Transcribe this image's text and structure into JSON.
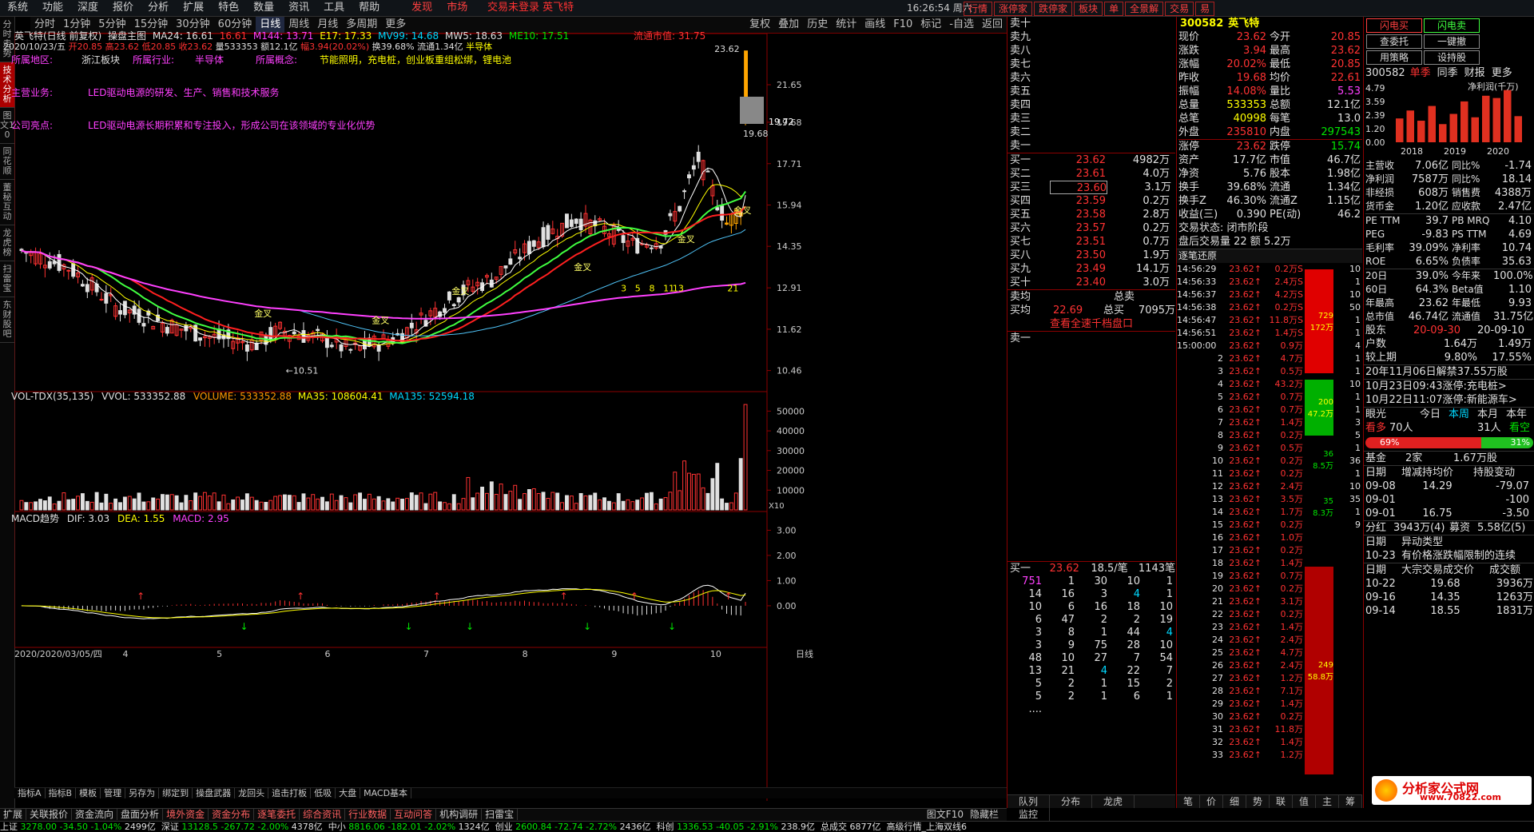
{
  "menu": [
    "系统",
    "功能",
    "深度",
    "报价",
    "分析",
    "扩展",
    "特色",
    "数量",
    "资讯",
    "工具",
    "帮助"
  ],
  "menu_hot": [
    "发现",
    "市场"
  ],
  "login_status": "交易未登录",
  "stock_name_title": "英飞特",
  "clock": "16:26:54",
  "weekday": "周六",
  "top_right_buttons": [
    "行情",
    "涨停家",
    "跌停家",
    "板块",
    "单",
    "全景解",
    "交易",
    "易"
  ],
  "toolbar_left": [
    "分时",
    "1分钟",
    "5分钟",
    "15分钟",
    "30分钟",
    "60分钟",
    "日线",
    "周线",
    "月线",
    "多周期",
    "更多"
  ],
  "toolbar_right": [
    "复权",
    "叠加",
    "历史",
    "统计",
    "画线",
    "F10",
    "标记",
    "-自选",
    "返回"
  ],
  "left_tabs": [
    "分时走势",
    "技术分析",
    "图文10",
    "同花顺",
    "董秘互动",
    "龙虎榜",
    "扫雷宝",
    "东财股吧"
  ],
  "chart_header": {
    "title": "英飞特(日线 前复权)",
    "indicator": "操盘主图",
    "ma24": "MA24: 16.61",
    "v1": "16.61",
    "m144": "M144: 13.71",
    "e17": "E17: 17.33",
    "mv99": "MV99: 14.68",
    "mw5": "MW5: 18.63",
    "me10": "ME10: 17.51",
    "date_line": "2020/10/23/五",
    "open": "开20.85",
    "high": "高23.62",
    "low": "低20.85",
    "close": "收23.62",
    "volume": "量533353",
    "amount": "额12.1亿",
    "change": "幅3.94(20.02%)",
    "turnover": "换39.68%",
    "float_shares": "流通1.34亿",
    "sector": "半导体",
    "market_value": "流通市值: 31.75"
  },
  "info": {
    "region_label": "所属地区:",
    "region": "浙江板块",
    "industry_label": "所属行业:",
    "industry": "半导体",
    "concept_label": "所属概念:",
    "concept": "节能照明，充电桩，创业板重组松绑，锂电池",
    "business_label": "主营业务:",
    "business": "LED驱动电源的研发、生产、销售和技术服务",
    "highlight_label": "公司亮点:",
    "highlight": "LED驱动电源长期积累和专注投入，形成公司在该领域的专业化优势"
  },
  "price_axis": [
    "21.65",
    "19.68",
    "17.71",
    "15.94",
    "14.35",
    "12.91",
    "11.62",
    "10.46"
  ],
  "price_labels": {
    "high": "23.62",
    "low": "10.51",
    "current": "19.72",
    "current2": "19.68"
  },
  "golden_cross": "金叉",
  "seq_marks": [
    "3",
    "5",
    "8",
    "11",
    "13",
    "21"
  ],
  "vol_header": {
    "name": "VOL-TDX(35,135)",
    "vvol": "VVOL: 533352.88",
    "volume": "VOLUME: 533352.88",
    "ma35": "MA35: 108604.41",
    "ma135": "MA135: 52594.18"
  },
  "vol_axis": [
    "50000",
    "40000",
    "30000",
    "20000",
    "10000"
  ],
  "vol_unit": "X10",
  "macd_header": {
    "name": "MACD趋势",
    "dif": "DIF: 3.03",
    "dea": "DEA: 1.55",
    "macd": "MACD: 2.95"
  },
  "macd_axis": [
    "3.00",
    "2.00",
    "1.00",
    "0.00"
  ],
  "date_axis": {
    "first": "2020/2020/03/05/四",
    "months": [
      "4",
      "5",
      "6",
      "7",
      "8",
      "9",
      "10"
    ],
    "period": "日线"
  },
  "bottom_tabs": [
    "指标A",
    "指标B",
    "模板",
    "管理",
    "另存为",
    "绑定到",
    "操盘武器",
    "龙回头",
    "追击打板",
    "低吸",
    "大盘",
    "MACD基本"
  ],
  "bottom_tabs2": [
    "扩展",
    "关联报价",
    "资金流向",
    "盘面分析",
    "境外资金",
    "资金分布",
    "逐笔委托",
    "综合资讯",
    "行业数据",
    "互动问答",
    "机构调研",
    "扫雷宝"
  ],
  "bottom_right": [
    "图文F10",
    "隐藏栏"
  ],
  "mid_tabs": [
    "队列",
    "分布",
    "龙虎",
    "监控"
  ],
  "right_tabs": [
    "笔",
    "价",
    "细",
    "势",
    "联",
    "值",
    "主",
    "筹"
  ],
  "order_book": {
    "sell_labels": [
      "卖十",
      "卖九",
      "卖八",
      "卖七",
      "卖六",
      "卖五",
      "卖四",
      "卖三",
      "卖二",
      "卖一"
    ],
    "buy": [
      {
        "label": "买一",
        "price": "23.62",
        "vol": "4982万"
      },
      {
        "label": "买二",
        "price": "23.61",
        "vol": "4.0万"
      },
      {
        "label": "买三",
        "price": "23.60",
        "vol": "3.1万"
      },
      {
        "label": "买四",
        "price": "23.59",
        "vol": "0.2万"
      },
      {
        "label": "买五",
        "price": "23.58",
        "vol": "2.8万"
      },
      {
        "label": "买六",
        "price": "23.57",
        "vol": "0.2万"
      },
      {
        "label": "买七",
        "price": "23.51",
        "vol": "0.7万"
      },
      {
        "label": "买八",
        "price": "23.50",
        "vol": "1.9万"
      },
      {
        "label": "买九",
        "price": "23.49",
        "vol": "14.1万"
      },
      {
        "label": "买十",
        "price": "23.40",
        "vol": "3.0万"
      }
    ],
    "avg_buy_label": "买均",
    "avg_buy": "22.69",
    "total_buy_label": "总买",
    "total_buy": "7095万",
    "avg_sell_label": "卖均",
    "total_sell_label": "总卖",
    "link": "查看全速千档盘口",
    "sell1": "卖一",
    "queue_header": {
      "label": "买一",
      "price": "23.62",
      "per": "18.5/笔",
      "count": "1143笔"
    },
    "queue": [
      [
        "751",
        "1",
        "30",
        "10",
        "1"
      ],
      [
        "14",
        "16",
        "3",
        "4",
        "1"
      ],
      [
        "10",
        "6",
        "16",
        "18",
        "10"
      ],
      [
        "6",
        "47",
        "2",
        "2",
        "19"
      ],
      [
        "3",
        "8",
        "1",
        "44",
        "4"
      ],
      [
        "3",
        "9",
        "75",
        "28",
        "10"
      ],
      [
        "48",
        "10",
        "27",
        "7",
        "54"
      ],
      [
        "13",
        "21",
        "4",
        "22",
        "7"
      ],
      [
        "5",
        "2",
        "1",
        "15",
        "2"
      ],
      [
        "5",
        "2",
        "1",
        "6",
        "1"
      ],
      [
        "....",
        "",
        "",
        "",
        ""
      ]
    ]
  },
  "quote": {
    "code": "300582",
    "name": "英飞特",
    "rows": [
      [
        "现价",
        "23.62",
        "今开",
        "20.85"
      ],
      [
        "涨跌",
        "3.94",
        "最高",
        "23.62"
      ],
      [
        "涨幅",
        "20.02%",
        "最低",
        "20.85"
      ],
      [
        "昨收",
        "19.68",
        "均价",
        "22.61"
      ],
      [
        "振幅",
        "14.08%",
        "量比",
        "5.53"
      ],
      [
        "总量",
        "533353",
        "总额",
        "12.1亿"
      ],
      [
        "总笔",
        "40998",
        "每笔",
        "13.0"
      ],
      [
        "外盘",
        "235810",
        "内盘",
        "297543"
      ],
      [
        "涨停",
        "23.62",
        "跌停",
        "15.74"
      ],
      [
        "资产",
        "17.7亿",
        "市值",
        "46.7亿"
      ],
      [
        "净资",
        "5.76",
        "股本",
        "1.98亿"
      ],
      [
        "换手",
        "39.68%",
        "流通",
        "1.34亿"
      ],
      [
        "换手Z",
        "46.30%",
        "流通Z",
        "1.15亿"
      ],
      [
        "收益(三)",
        "0.390",
        "PE(动)",
        "46.2"
      ]
    ],
    "trade_status": "交易状态: 闭市阶段",
    "after_hours": "盘后交易量 22 额 5.2万",
    "tick_title": "逐笔还原",
    "ticks": [
      [
        "14:56:29",
        "23.62",
        "0.2万S"
      ],
      [
        "14:56:33",
        "23.62",
        "2.4万S"
      ],
      [
        "14:56:37",
        "23.62",
        "4.2万S"
      ],
      [
        "14:56:38",
        "23.62",
        "0.2万S"
      ],
      [
        "14:56:47",
        "23.62",
        "11.8万S"
      ],
      [
        "14:56:51",
        "23.62",
        "1.4万S"
      ],
      [
        "15:00:00",
        "23.62",
        "0.9万"
      ],
      [
        "2",
        "23.62",
        "4.7万"
      ],
      [
        "3",
        "23.62",
        "0.5万"
      ],
      [
        "4",
        "23.62",
        "43.2万"
      ],
      [
        "5",
        "23.62",
        "0.7万"
      ],
      [
        "6",
        "23.62",
        "0.7万"
      ],
      [
        "7",
        "23.62",
        "1.4万"
      ],
      [
        "8",
        "23.62",
        "0.2万"
      ],
      [
        "9",
        "23.62",
        "0.5万"
      ],
      [
        "10",
        "23.62",
        "0.2万"
      ],
      [
        "11",
        "23.62",
        "0.2万"
      ],
      [
        "12",
        "23.62",
        "2.4万"
      ],
      [
        "13",
        "23.62",
        "3.5万"
      ],
      [
        "14",
        "23.62",
        "1.7万"
      ],
      [
        "15",
        "23.62",
        "0.2万"
      ],
      [
        "16",
        "23.62",
        "1.0万"
      ],
      [
        "17",
        "23.62",
        "0.2万"
      ],
      [
        "18",
        "23.62",
        "1.4万"
      ],
      [
        "19",
        "23.62",
        "0.7万"
      ],
      [
        "20",
        "23.62",
        "0.2万"
      ],
      [
        "21",
        "23.62",
        "3.1万"
      ],
      [
        "22",
        "23.62",
        "0.2万"
      ],
      [
        "23",
        "23.62",
        "1.4万"
      ],
      [
        "24",
        "23.62",
        "2.4万"
      ],
      [
        "25",
        "23.62",
        "4.7万"
      ],
      [
        "26",
        "23.62",
        "2.4万"
      ],
      [
        "27",
        "23.62",
        "1.2万"
      ],
      [
        "28",
        "23.62",
        "7.1万"
      ],
      [
        "29",
        "23.62",
        "1.4万"
      ],
      [
        "30",
        "23.62",
        "0.2万"
      ],
      [
        "31",
        "23.62",
        "11.8万"
      ],
      [
        "32",
        "23.62",
        "1.4万"
      ],
      [
        "33",
        "23.62",
        "1.2万"
      ]
    ],
    "tick_side": [
      "10",
      "1",
      "10",
      "50",
      "1",
      "1",
      "4",
      "1",
      "1",
      "10",
      "1",
      "1",
      "3",
      "5",
      "1",
      "36",
      "1",
      "10",
      "35",
      "1",
      "9"
    ],
    "blocks": [
      {
        "top": "729",
        "bottom": "172万"
      },
      {
        "top": "200",
        "bottom": "47.2万"
      },
      {
        "top": "36",
        "bottom": "8.5万"
      },
      {
        "top": "35",
        "bottom": "8.3万"
      },
      {
        "top": "249",
        "bottom": "58.8万"
      }
    ]
  },
  "fin": {
    "buttons": [
      "闪电买",
      "闪电卖",
      "查委托",
      "一键撤",
      "用策略",
      "设持股"
    ],
    "code": "300582",
    "tabs": [
      "单季",
      "同季",
      "财报",
      "更多"
    ],
    "chart_title": "净利润(千万)",
    "chart_yaxis": [
      "4.79",
      "3.59",
      "2.39",
      "1.20",
      "0.00"
    ],
    "chart_years": [
      "2018",
      "2019",
      "2020"
    ],
    "chart_values": [
      2.1,
      2.8,
      1.9,
      3.2,
      1.6,
      2.5,
      3.6,
      2.2,
      4.1,
      3.9,
      4.6,
      2.3
    ],
    "rows": [
      [
        "主营收",
        "7.06亿",
        "同比%",
        "-1.74"
      ],
      [
        "净利润",
        "7587万",
        "同比%",
        "18.14"
      ],
      [
        "非经损",
        "608万",
        "销售费",
        "4388万"
      ],
      [
        "货币金",
        "1.20亿",
        "应收款",
        "2.47亿"
      ],
      [
        "PE TTM",
        "39.7",
        "PB MRQ",
        "4.10"
      ],
      [
        "PEG",
        "-9.83",
        "PS TTM",
        "4.69"
      ],
      [
        "毛利率",
        "39.09%",
        "净利率",
        "10.74"
      ],
      [
        "ROE",
        "6.65%",
        "负债率",
        "35.63"
      ],
      [
        "20日",
        "39.0%",
        "今年来",
        "100.0%"
      ],
      [
        "60日",
        "64.3%",
        "Beta值",
        "1.10"
      ],
      [
        "年最高",
        "23.62",
        "年最低",
        "9.93"
      ],
      [
        "总市值",
        "46.74亿",
        "流通值",
        "31.75亿"
      ]
    ],
    "holder_label": "股东",
    "holder_dates": [
      "20-09-30",
      "20-09-10"
    ],
    "holder_rows": [
      [
        "户数",
        "1.64万",
        "1.49万"
      ],
      [
        "较上期",
        "9.80%",
        "17.55%"
      ]
    ],
    "unlock": "20年11月06日解禁37.55万股",
    "news": [
      "10月23日09:43涨停:充电桩>",
      "10月22日11:07涨停:新能源车>"
    ],
    "eye_label": "眼光",
    "eye_tabs": [
      "今日",
      "本周",
      "本月",
      "本年"
    ],
    "eye_bull": "看多",
    "eye_bull_cnt": "70人",
    "eye_bear_cnt": "31人",
    "eye_bear": "看空",
    "bull_pct": "69%",
    "bear_pct": "31%",
    "fund": [
      "基金",
      "2家",
      "1.67万股"
    ],
    "inst_header": [
      "日期",
      "增减持均价",
      "持股变动"
    ],
    "inst_rows": [
      [
        "09-08",
        "14.29",
        "-79.07"
      ],
      [
        "09-01",
        "",
        "-100"
      ],
      [
        "09-01",
        "16.75",
        "-3.50"
      ]
    ],
    "div": [
      "分红",
      "3943万(4)",
      "募资",
      "5.58亿(5)"
    ],
    "abn_header": [
      "日期",
      "异动类型"
    ],
    "abn_rows": [
      [
        "10-23",
        "有价格涨跌幅限制的连续"
      ]
    ],
    "block_header": [
      "日期",
      "大宗交易成交价",
      "成交额"
    ],
    "block_rows": [
      [
        "10-22",
        "19.68",
        "3936万"
      ],
      [
        "09-16",
        "14.35",
        "1263万"
      ],
      [
        "09-14",
        "18.55",
        "1831万"
      ]
    ]
  },
  "status": {
    "sh": "上证",
    "sh_val": "3278.00",
    "sh_chg": "-34.50",
    "sh_pct": "-1.04%",
    "sh_amt": "2499亿",
    "sz": "深证",
    "sz_val": "13128.5",
    "sz_chg": "-267.72",
    "sz_pct": "-2.00%",
    "sz_amt": "4378亿",
    "zx": "中小",
    "zx_val": "8816.06",
    "zx_chg": "-182.01",
    "zx_pct": "-2.02%",
    "zx_amt": "1324亿",
    "cy": "创业",
    "cy_val": "2600.84",
    "cy_chg": "-72.74",
    "cy_pct": "-2.72%",
    "cy_amt": "2436亿",
    "kc": "科创",
    "kc_val": "1336.53",
    "kc_chg": "-40.05",
    "kc_pct": "-2.91%",
    "kc_amt": "238.9亿",
    "total_label": "总成交",
    "total": "6877亿",
    "server": "高级行情_上海双线6"
  },
  "watermark": {
    "brand": "分析家公式网",
    "url": "www.70822.com"
  },
  "colors": {
    "up": "#ff3232",
    "down": "#00e600",
    "ma_yellow": "#ffff00",
    "ma_magenta": "#ff40ff",
    "ma_cyan": "#4fc3f7",
    "ma_red": "#ff2020",
    "ma_green": "#40ff40"
  }
}
